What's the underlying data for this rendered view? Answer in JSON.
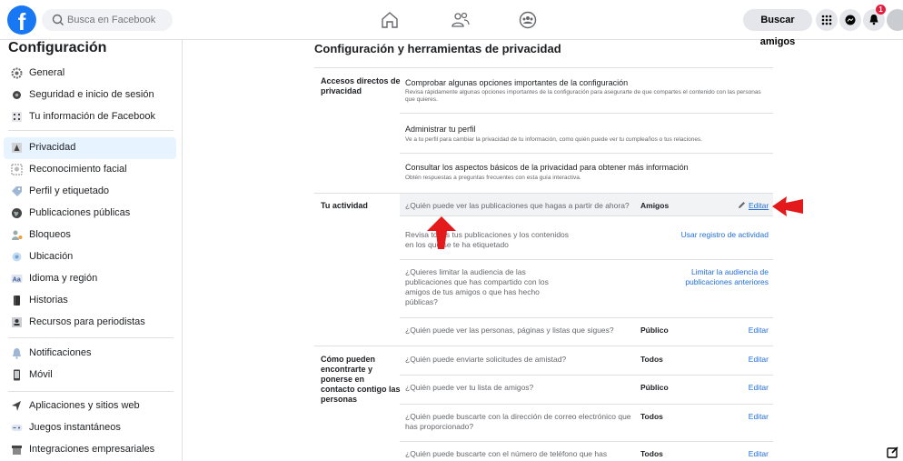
{
  "topbar": {
    "logo": "f",
    "search_placeholder": "Busca en Facebook",
    "nav_icons": [
      "home-icon",
      "friends-icon",
      "groups-icon"
    ],
    "find_friends_label": "Buscar amigos",
    "notification_count": "1"
  },
  "sidebar": {
    "title": "Configuración",
    "groups": [
      [
        {
          "label": "General",
          "icon": "gear-icon"
        },
        {
          "label": "Seguridad e inicio de sesión",
          "icon": "shield-icon"
        },
        {
          "label": "Tu información de Facebook",
          "icon": "info-grid-icon"
        }
      ],
      [
        {
          "label": "Privacidad",
          "icon": "lock-icon",
          "active": true
        },
        {
          "label": "Reconocimiento facial",
          "icon": "face-icon"
        },
        {
          "label": "Perfil y etiquetado",
          "icon": "tag-icon"
        },
        {
          "label": "Publicaciones públicas",
          "icon": "globe-icon"
        },
        {
          "label": "Bloqueos",
          "icon": "block-user-icon"
        },
        {
          "label": "Ubicación",
          "icon": "location-icon"
        },
        {
          "label": "Idioma y región",
          "icon": "language-icon"
        },
        {
          "label": "Historias",
          "icon": "book-icon"
        },
        {
          "label": "Recursos para periodistas",
          "icon": "id-card-icon"
        }
      ],
      [
        {
          "label": "Notificaciones",
          "icon": "bell-icon"
        },
        {
          "label": "Móvil",
          "icon": "phone-icon"
        }
      ],
      [
        {
          "label": "Aplicaciones y sitios web",
          "icon": "apps-icon"
        },
        {
          "label": "Juegos instantáneos",
          "icon": "game-icon"
        },
        {
          "label": "Integraciones empresariales",
          "icon": "business-icon"
        }
      ]
    ]
  },
  "main": {
    "title": "Configuración y herramientas de privacidad",
    "shortcuts": {
      "label": "Accesos directos de privacidad",
      "items": [
        {
          "title": "Comprobar algunas opciones importantes de la configuración",
          "desc": "Revisa rápidamente algunas opciones importantes de la configuración para asegurarte de que compartes el contenido con las personas que quieres."
        },
        {
          "title": "Administrar tu perfil",
          "desc": "Ve a tu perfil para cambiar la privacidad de tu información, como quién puede ver tu cumpleaños o tus relaciones."
        },
        {
          "title": "Consultar los aspectos básicos de la privacidad para obtener más información",
          "desc": "Obtén respuestas a preguntas frecuentes con esta guía interactiva."
        }
      ]
    },
    "activity": {
      "label": "Tu actividad",
      "rows": [
        {
          "q": "¿Quién puede ver las publicaciones que hagas a partir de ahora?",
          "value": "Amigos",
          "link": "Editar"
        },
        {
          "q": "Revisa todas tus publicaciones y los contenidos en los que se te ha etiquetado",
          "value": "",
          "link": "Usar registro de actividad"
        },
        {
          "q": "¿Quieres limitar la audiencia de las publicaciones que has compartido con los amigos de tus amigos o que has hecho públicas?",
          "value": "",
          "link": "Limitar la audiencia de publicaciones anteriores"
        },
        {
          "q": "¿Quién puede ver las personas, páginas y listas que sigues?",
          "value": "Público",
          "link": "Editar"
        }
      ]
    },
    "contact": {
      "label": "Cómo pueden encontrarte y ponerse en contacto contigo las personas",
      "rows": [
        {
          "q": "¿Quién puede enviarte solicitudes de amistad?",
          "value": "Todos",
          "link": "Editar"
        },
        {
          "q": "¿Quién puede ver tu lista de amigos?",
          "value": "Público",
          "link": "Editar"
        },
        {
          "q": "¿Quién puede buscarte con la dirección de correo electrónico que has proporcionado?",
          "value": "Todos",
          "link": "Editar"
        },
        {
          "q": "¿Quién puede buscarte con el número de teléfono que has",
          "value": "Todos",
          "link": "Editar"
        }
      ]
    }
  },
  "colors": {
    "brand": "#1877f2",
    "link": "#216fdb",
    "annotation_arrow": "#e4191c",
    "active_bg": "#e7f3ff"
  }
}
